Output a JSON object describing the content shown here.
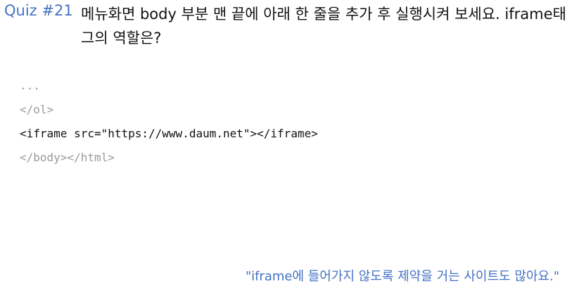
{
  "quiz": {
    "label": "Quiz #21",
    "question": "메뉴화면 body 부분 맨 끝에 아래 한 줄을 추가 후 실행시켜 보세요. iframe태그의 역할은?"
  },
  "code": {
    "lines": [
      "...",
      "</ol>",
      "<iframe src=\"https://www.daum.net\"></iframe>",
      "</body></html>"
    ]
  },
  "note": "\"iframe에 들어가지 않도록 제약을 거는 사이트도 많아요.\"",
  "colors": {
    "accent": "#4472c4",
    "code_dim": "#9a9a9a",
    "text": "#111111"
  }
}
